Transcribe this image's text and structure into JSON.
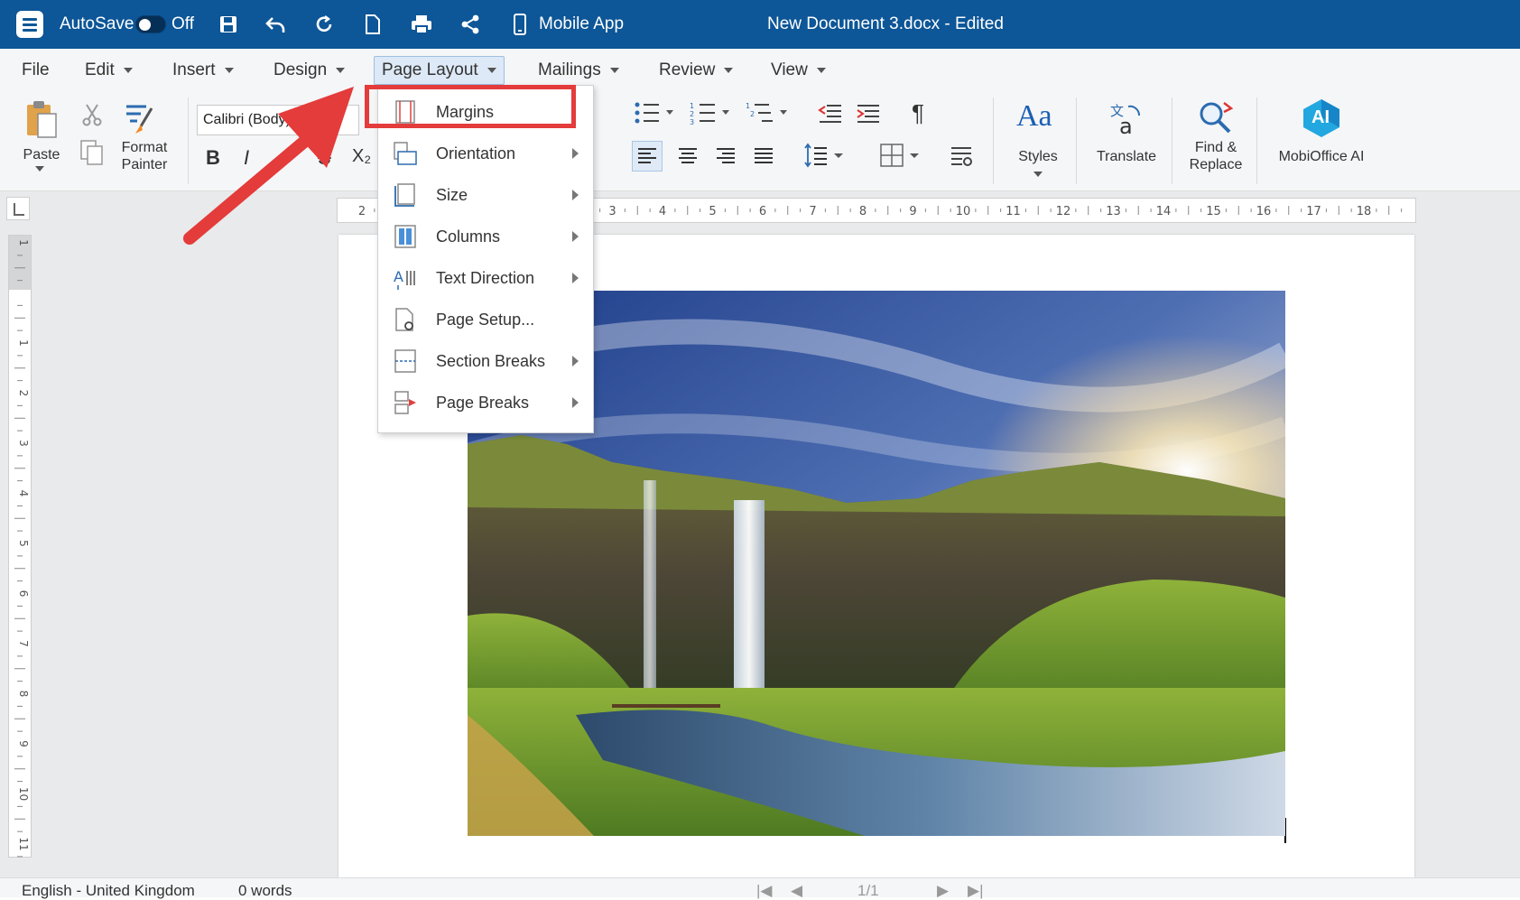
{
  "titlebar": {
    "autosave_label": "AutoSave",
    "autosave_state": "Off",
    "mobile_app_label": "Mobile App",
    "document_title": "New Document 3.docx - Edited"
  },
  "menubar": {
    "items": [
      {
        "label": "File",
        "has_caret": false
      },
      {
        "label": "Edit",
        "has_caret": true
      },
      {
        "label": "Insert",
        "has_caret": true
      },
      {
        "label": "Design",
        "has_caret": true
      },
      {
        "label": "Page Layout",
        "has_caret": true,
        "active": true
      },
      {
        "label": "Mailings",
        "has_caret": true
      },
      {
        "label": "Review",
        "has_caret": true
      },
      {
        "label": "View",
        "has_caret": true
      }
    ]
  },
  "ribbon": {
    "paste_label": "Paste",
    "format_painter_label_1": "Format",
    "format_painter_label_2": "Painter",
    "font_name": "Calibri (Body)",
    "bold": "B",
    "italic": "I",
    "strike": "S",
    "subscript": "X₂",
    "styles_label": "Styles",
    "styles_glyph": "Aa",
    "translate_label": "Translate",
    "find_label_1": "Find &",
    "find_label_2": "Replace",
    "ai_label": "MobiOffice AI",
    "ai_badge": "AI",
    "pilcrow": "¶"
  },
  "ruler": {
    "h_numbers": [
      "2",
      "1",
      "",
      "1",
      "2",
      "3",
      "4",
      "5",
      "6",
      "7",
      "8",
      "9",
      "10",
      "11",
      "12",
      "13",
      "14",
      "15",
      "16",
      "17",
      "18"
    ],
    "v_numbers": [
      "1",
      "",
      "1",
      "2",
      "3",
      "4",
      "5",
      "6",
      "7",
      "8",
      "9",
      "10",
      "11"
    ]
  },
  "dropdown": {
    "items": [
      {
        "label": "Margins",
        "icon": "margins-icon",
        "submenu": false
      },
      {
        "label": "Orientation",
        "icon": "orientation-icon",
        "submenu": true
      },
      {
        "label": "Size",
        "icon": "size-icon",
        "submenu": true
      },
      {
        "label": "Columns",
        "icon": "columns-icon",
        "submenu": true
      },
      {
        "label": "Text Direction",
        "icon": "text-direction-icon",
        "submenu": true
      },
      {
        "label": "Page Setup...",
        "icon": "page-setup-icon",
        "submenu": false
      },
      {
        "label": "Section Breaks",
        "icon": "section-breaks-icon",
        "submenu": true
      },
      {
        "label": "Page Breaks",
        "icon": "page-breaks-icon",
        "submenu": true
      }
    ]
  },
  "statusbar": {
    "language": "English - United Kingdom",
    "words": "0 words",
    "page_indicator": "1/1"
  },
  "colors": {
    "titlebar": "#0d5697",
    "annotation": "#e43b3b",
    "menubar": "#f5f6f7"
  }
}
